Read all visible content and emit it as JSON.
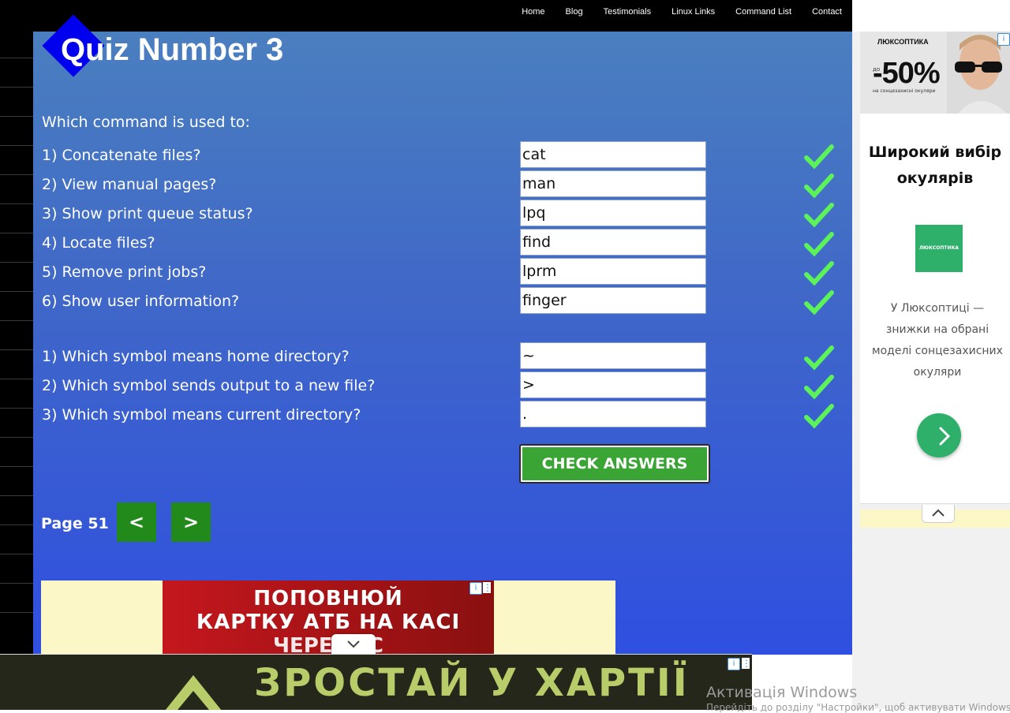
{
  "nav": {
    "items": [
      "Home",
      "Blog",
      "Testimonials",
      "Linux Links",
      "Command List",
      "Contact"
    ]
  },
  "quiz": {
    "title": "Quiz Number 3",
    "intro": "Which command is used to:",
    "commands": [
      {
        "question": "1) Concatenate files?",
        "answer": "cat",
        "correct": true
      },
      {
        "question": "2) View manual pages?",
        "answer": "man",
        "correct": true
      },
      {
        "question": "3) Show print queue status?",
        "answer": "lpq",
        "correct": true
      },
      {
        "question": "4) Locate files?",
        "answer": "find",
        "correct": true
      },
      {
        "question": "5) Remove print jobs?",
        "answer": "lprm",
        "correct": true
      },
      {
        "question": "6) Show user information?",
        "answer": "finger",
        "correct": true
      }
    ],
    "symbols": [
      {
        "question": "1) Which symbol means home directory?",
        "answer": "~",
        "correct": true
      },
      {
        "question": "2) Which symbol sends output to a new file?",
        "answer": ">",
        "correct": true
      },
      {
        "question": "3) Which symbol means current directory?",
        "answer": ".",
        "correct": true
      }
    ],
    "check_label": "CHECK ANSWERS",
    "check_icon": "checkmark-icon",
    "check_color": "#5cf25a"
  },
  "pager": {
    "label": "Page 51",
    "prev": "<",
    "next": ">"
  },
  "bottom_ad": {
    "line1": "ПОПОВНЮЙ",
    "line2": "КАРТКУ АТБ НА КАСІ",
    "line3": "ЧЕРЕЗ ЕС"
  },
  "side_ad": {
    "brand": "ЛЮКСОПТИКА",
    "discount": "-50%",
    "discount_prefix": "до",
    "discount_sub": "на сонцезахисні окуляри",
    "heading": "Широкий вибір окулярів",
    "logo_text": "ЛЮКСОПТИКА",
    "description": "У Люксоптиці — знижки на обрані моделі сонцезахисних окуляри"
  },
  "anchor_ad": {
    "text": "ЗРОСТАЙ У ХАРТІЇ"
  },
  "windows": {
    "activation": "Активація Windows",
    "activation_sub": "Перейдіть до розділу \"Настройки\", щоб активувати Windows."
  },
  "colors": {
    "nav_bg": "#000000",
    "panel_top": "#4a7fbf",
    "panel_bottom": "#2f4fe0",
    "check_button": "#3aa534",
    "pager_button": "#228a1a",
    "ad_green": "#2eb06a"
  }
}
